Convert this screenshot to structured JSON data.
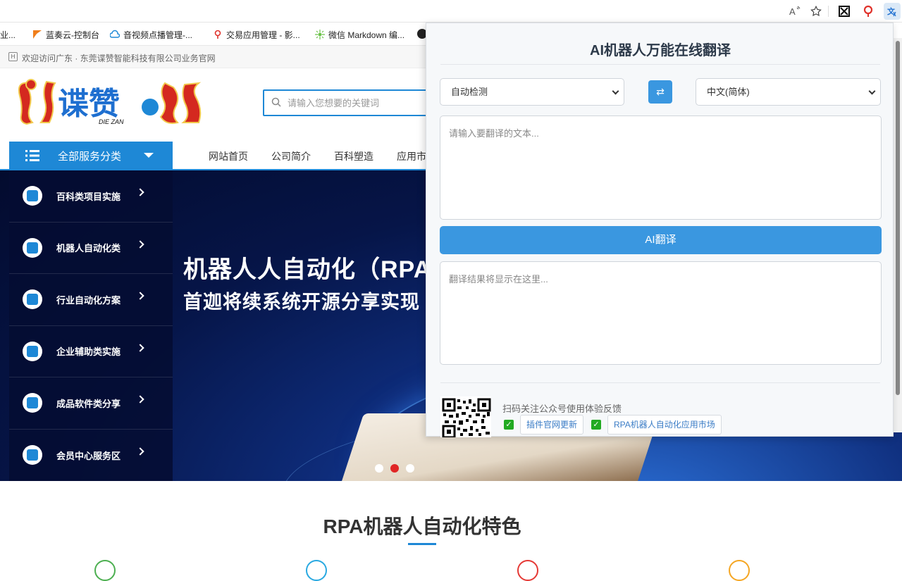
{
  "browser": {
    "toolbar_icons": [
      "read-aloud-icon",
      "favorite-star-icon",
      "extension-puzzle-icon",
      "extension-pin-icon",
      "translate-extension-icon"
    ],
    "bookmarks": [
      {
        "label": "业...",
        "icon": "folder-icon"
      },
      {
        "label": "蓝奏云-控制台",
        "icon": "flag-icon"
      },
      {
        "label": "音视频点播管理-...",
        "icon": "cloud-icon"
      },
      {
        "label": "交易应用管理 - 影...",
        "icon": "location-pin-icon"
      },
      {
        "label": "微信 Markdown 编...",
        "icon": "sparkle-icon"
      }
    ]
  },
  "site": {
    "welcome": "欢迎访问广东 · 东莞谍赞智能科技有限公司业务官网",
    "logo_text": "谍赞",
    "logo_sub": "DIE ZAN",
    "search_placeholder": "请输入您想要的关键词",
    "all_categories": "全部服务分类",
    "nav": [
      "网站首页",
      "公司简介",
      "百科塑造",
      "应用市"
    ],
    "categories": [
      {
        "label": "百科类项目实施",
        "icon": "building-icon"
      },
      {
        "label": "机器人自动化类",
        "icon": "edit-icon"
      },
      {
        "label": "行业自动化方案",
        "icon": "document-icon"
      },
      {
        "label": "企业辅助类实施",
        "icon": "user-card-icon"
      },
      {
        "label": "成品软件类分享",
        "icon": "monitor-icon"
      },
      {
        "label": "会员中心服务区",
        "icon": "grid-icon"
      }
    ],
    "banner_headline": "机器人人自动化（RPA",
    "banner_subline": "首迦将续系统开源分享实现",
    "carousel": {
      "count": 3,
      "active_index": 1
    },
    "features_title": "RPA机器人自动化特色",
    "feature_colors": [
      "#4caf50",
      "#29a9e1",
      "#e53935",
      "#f5a623"
    ]
  },
  "popup": {
    "title": "AI机器人万能在线翻译",
    "source_lang": "自动检测",
    "target_lang": "中文(简体)",
    "swap_symbol": "⇄",
    "input_placeholder": "请输入要翻译的文本...",
    "translate_button": "AI翻译",
    "output_placeholder": "翻译结果将显示在这里...",
    "follow_text": "扫码关注公众号使用体验反馈",
    "links": [
      "插件官网更新",
      "RPA机器人自动化应用市场"
    ],
    "accent": "#3a97e0"
  }
}
